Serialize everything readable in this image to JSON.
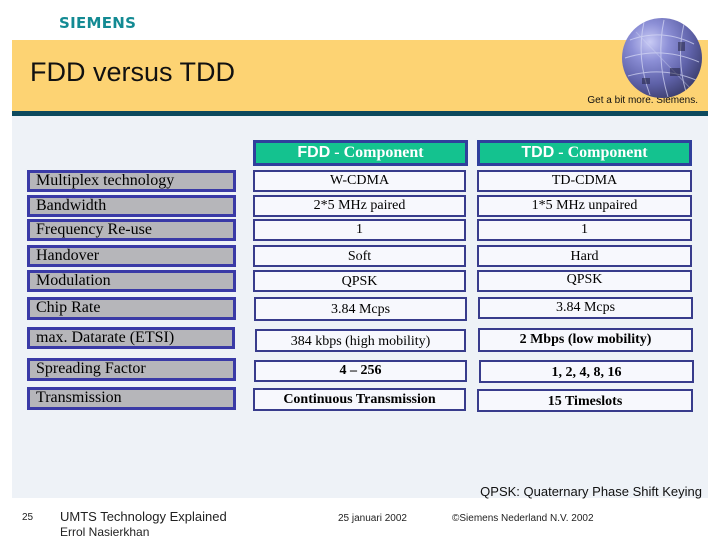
{
  "header": {
    "logo": "SIEMENS",
    "title": "FDD versus TDD",
    "tagline": "Get a bit more. Siemens.",
    "globe_icon": "globe-icon"
  },
  "table": {
    "columns": [
      {
        "abbr": "FDD",
        "rest": " - Component"
      },
      {
        "abbr": "TDD",
        "rest": " - Component"
      }
    ],
    "rows": [
      {
        "label": "Multiplex technology",
        "fdd": "W-CDMA",
        "tdd": "TD-CDMA"
      },
      {
        "label": "Bandwidth",
        "fdd": "2*5 MHz paired",
        "tdd": "1*5 MHz unpaired"
      },
      {
        "label": "Frequency Re-use",
        "fdd": "1",
        "tdd": "1"
      },
      {
        "label": "Handover",
        "fdd": "Soft",
        "tdd": "Hard"
      },
      {
        "label": "Modulation",
        "fdd": "QPSK",
        "tdd": "QPSK"
      },
      {
        "label": "Chip Rate",
        "fdd": "3.84 Mcps",
        "tdd": "3.84 Mcps"
      },
      {
        "label": "max. Datarate (ETSI)",
        "fdd": "384 kbps (high mobility)",
        "tdd": "2 Mbps (low mobility)"
      },
      {
        "label": "Spreading Factor",
        "fdd": "4 – 256",
        "tdd": "1, 2, 4, 8, 16"
      },
      {
        "label": " Transmission",
        "fdd": "Continuous Transmission",
        "tdd": "15 Timeslots"
      }
    ]
  },
  "footnote": "QPSK: Quaternary Phase Shift Keying",
  "footer": {
    "page_number": "25",
    "presentation_title": "UMTS Technology Explained",
    "author": "Errol Nasierkhan",
    "date": "25 januari 2002",
    "copyright": "©Siemens Nederland N.V. 2002"
  }
}
